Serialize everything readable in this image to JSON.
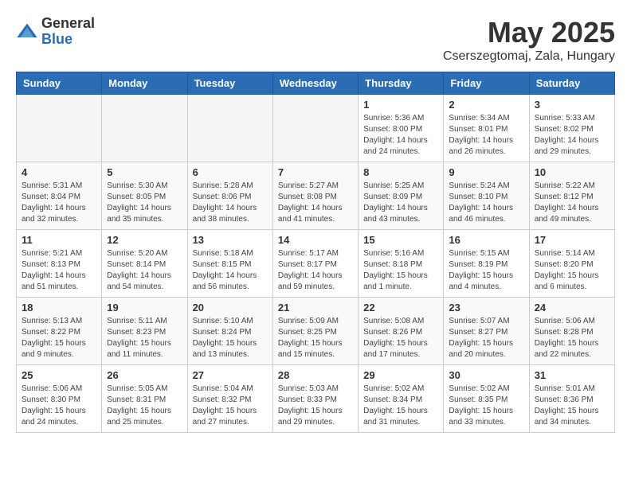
{
  "logo": {
    "general": "General",
    "blue": "Blue"
  },
  "header": {
    "month": "May 2025",
    "location": "Cserszegtomaj, Zala, Hungary"
  },
  "weekdays": [
    "Sunday",
    "Monday",
    "Tuesday",
    "Wednesday",
    "Thursday",
    "Friday",
    "Saturday"
  ],
  "weeks": [
    [
      {
        "day": "",
        "info": ""
      },
      {
        "day": "",
        "info": ""
      },
      {
        "day": "",
        "info": ""
      },
      {
        "day": "",
        "info": ""
      },
      {
        "day": "1",
        "info": "Sunrise: 5:36 AM\nSunset: 8:00 PM\nDaylight: 14 hours\nand 24 minutes."
      },
      {
        "day": "2",
        "info": "Sunrise: 5:34 AM\nSunset: 8:01 PM\nDaylight: 14 hours\nand 26 minutes."
      },
      {
        "day": "3",
        "info": "Sunrise: 5:33 AM\nSunset: 8:02 PM\nDaylight: 14 hours\nand 29 minutes."
      }
    ],
    [
      {
        "day": "4",
        "info": "Sunrise: 5:31 AM\nSunset: 8:04 PM\nDaylight: 14 hours\nand 32 minutes."
      },
      {
        "day": "5",
        "info": "Sunrise: 5:30 AM\nSunset: 8:05 PM\nDaylight: 14 hours\nand 35 minutes."
      },
      {
        "day": "6",
        "info": "Sunrise: 5:28 AM\nSunset: 8:06 PM\nDaylight: 14 hours\nand 38 minutes."
      },
      {
        "day": "7",
        "info": "Sunrise: 5:27 AM\nSunset: 8:08 PM\nDaylight: 14 hours\nand 41 minutes."
      },
      {
        "day": "8",
        "info": "Sunrise: 5:25 AM\nSunset: 8:09 PM\nDaylight: 14 hours\nand 43 minutes."
      },
      {
        "day": "9",
        "info": "Sunrise: 5:24 AM\nSunset: 8:10 PM\nDaylight: 14 hours\nand 46 minutes."
      },
      {
        "day": "10",
        "info": "Sunrise: 5:22 AM\nSunset: 8:12 PM\nDaylight: 14 hours\nand 49 minutes."
      }
    ],
    [
      {
        "day": "11",
        "info": "Sunrise: 5:21 AM\nSunset: 8:13 PM\nDaylight: 14 hours\nand 51 minutes."
      },
      {
        "day": "12",
        "info": "Sunrise: 5:20 AM\nSunset: 8:14 PM\nDaylight: 14 hours\nand 54 minutes."
      },
      {
        "day": "13",
        "info": "Sunrise: 5:18 AM\nSunset: 8:15 PM\nDaylight: 14 hours\nand 56 minutes."
      },
      {
        "day": "14",
        "info": "Sunrise: 5:17 AM\nSunset: 8:17 PM\nDaylight: 14 hours\nand 59 minutes."
      },
      {
        "day": "15",
        "info": "Sunrise: 5:16 AM\nSunset: 8:18 PM\nDaylight: 15 hours\nand 1 minute."
      },
      {
        "day": "16",
        "info": "Sunrise: 5:15 AM\nSunset: 8:19 PM\nDaylight: 15 hours\nand 4 minutes."
      },
      {
        "day": "17",
        "info": "Sunrise: 5:14 AM\nSunset: 8:20 PM\nDaylight: 15 hours\nand 6 minutes."
      }
    ],
    [
      {
        "day": "18",
        "info": "Sunrise: 5:13 AM\nSunset: 8:22 PM\nDaylight: 15 hours\nand 9 minutes."
      },
      {
        "day": "19",
        "info": "Sunrise: 5:11 AM\nSunset: 8:23 PM\nDaylight: 15 hours\nand 11 minutes."
      },
      {
        "day": "20",
        "info": "Sunrise: 5:10 AM\nSunset: 8:24 PM\nDaylight: 15 hours\nand 13 minutes."
      },
      {
        "day": "21",
        "info": "Sunrise: 5:09 AM\nSunset: 8:25 PM\nDaylight: 15 hours\nand 15 minutes."
      },
      {
        "day": "22",
        "info": "Sunrise: 5:08 AM\nSunset: 8:26 PM\nDaylight: 15 hours\nand 17 minutes."
      },
      {
        "day": "23",
        "info": "Sunrise: 5:07 AM\nSunset: 8:27 PM\nDaylight: 15 hours\nand 20 minutes."
      },
      {
        "day": "24",
        "info": "Sunrise: 5:06 AM\nSunset: 8:28 PM\nDaylight: 15 hours\nand 22 minutes."
      }
    ],
    [
      {
        "day": "25",
        "info": "Sunrise: 5:06 AM\nSunset: 8:30 PM\nDaylight: 15 hours\nand 24 minutes."
      },
      {
        "day": "26",
        "info": "Sunrise: 5:05 AM\nSunset: 8:31 PM\nDaylight: 15 hours\nand 25 minutes."
      },
      {
        "day": "27",
        "info": "Sunrise: 5:04 AM\nSunset: 8:32 PM\nDaylight: 15 hours\nand 27 minutes."
      },
      {
        "day": "28",
        "info": "Sunrise: 5:03 AM\nSunset: 8:33 PM\nDaylight: 15 hours\nand 29 minutes."
      },
      {
        "day": "29",
        "info": "Sunrise: 5:02 AM\nSunset: 8:34 PM\nDaylight: 15 hours\nand 31 minutes."
      },
      {
        "day": "30",
        "info": "Sunrise: 5:02 AM\nSunset: 8:35 PM\nDaylight: 15 hours\nand 33 minutes."
      },
      {
        "day": "31",
        "info": "Sunrise: 5:01 AM\nSunset: 8:36 PM\nDaylight: 15 hours\nand 34 minutes."
      }
    ]
  ]
}
